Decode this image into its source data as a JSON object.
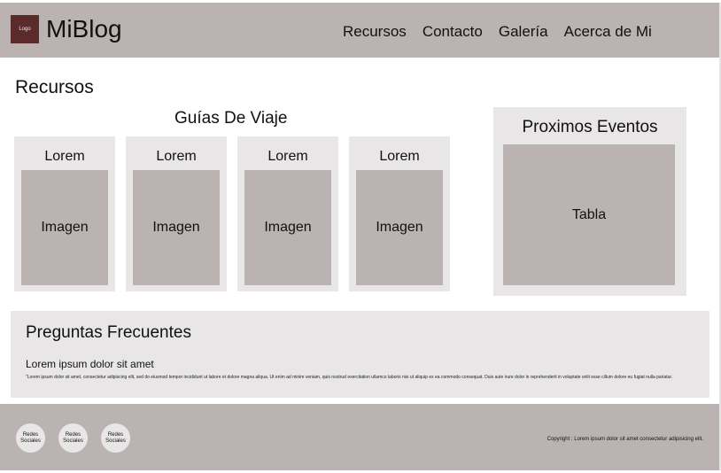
{
  "header": {
    "logo_label": "Logo",
    "brand": "MiBlog",
    "nav": [
      "Recursos",
      "Contacto",
      "Galería",
      "Acerca de Mi"
    ]
  },
  "main": {
    "title": "Recursos",
    "guides": {
      "title": "Guías De Viaje",
      "cards": [
        {
          "title": "Lorem",
          "image_label": "Imagen"
        },
        {
          "title": "Lorem",
          "image_label": "Imagen"
        },
        {
          "title": "Lorem",
          "image_label": "Imagen"
        },
        {
          "title": "Lorem",
          "image_label": "Imagen"
        }
      ]
    },
    "events": {
      "title": "Proximos Eventos",
      "table_label": "Tabla"
    }
  },
  "faq": {
    "title": "Preguntas Frecuentes",
    "question": "Lorem ipsum dolor sit amet",
    "answer": "\"Lorem ipsum dolor sit amet, consectetur adipiscing elit, sed do eiusmod tempor incididunt ut labore et dolore magna aliqua. Ut enim ad minim veniam, quis nostrud exercitation ullamco laboris nisi ut aliquip ex ea commodo consequat. Duis aute irure dolor in reprehenderit in voluptate velit esse cillum dolore eu fugiat nulla pariatur."
  },
  "footer": {
    "social": [
      "Redes Sociales",
      "Redes Sociales",
      "Redes Sociales"
    ],
    "copyright": "Copyright : Lorem ipsum dolor sit amet consectetur adipisicing elit."
  },
  "colors": {
    "header_bg": "#bbb3b1",
    "panel_bg": "#e8e6e6",
    "logo_bg": "#5b2a2a"
  }
}
